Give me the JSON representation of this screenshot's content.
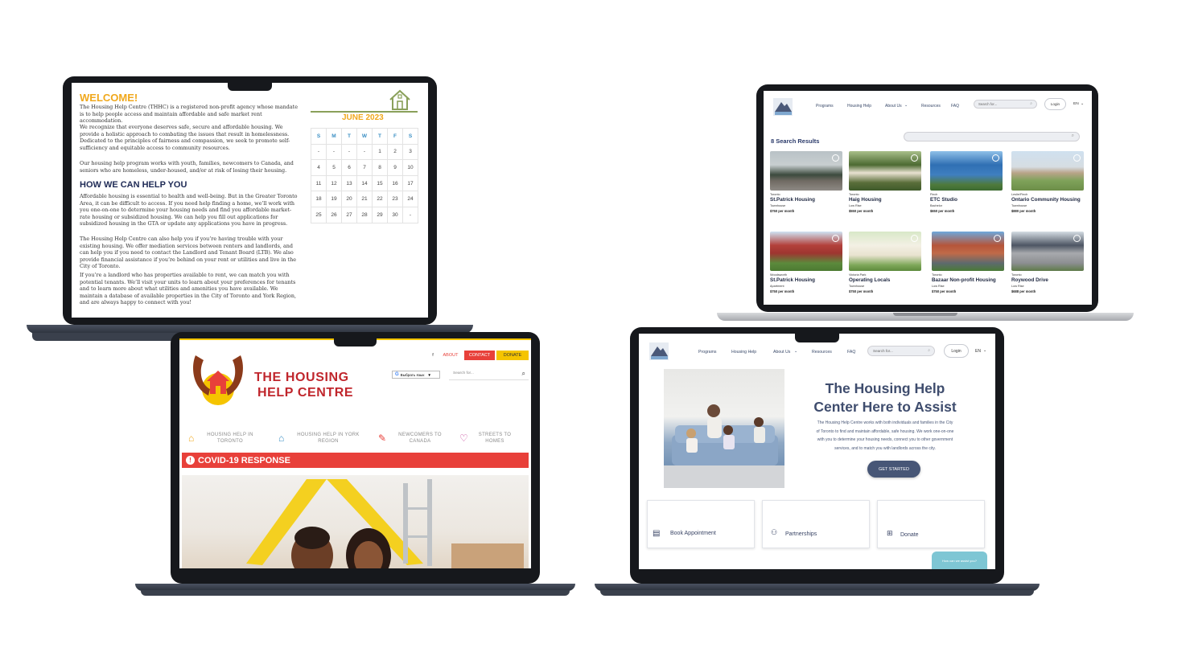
{
  "laptop1": {
    "welcome_title": "WELCOME!",
    "intro_paragraphs": [
      "The Housing Help Centre (THHC) is a registered non-profit agency whose mandate is to help people access and maintain affordable and safe market rent accommodation.",
      "We recognize that everyone deserves safe, secure and affordable housing. We provide a holistic approach to combating the issues that result in homelessness. Dedicated to the principles of fairness and compassion, we seek to promote self-sufficiency and equitable access to community resources.",
      "Our housing help program works with youth, families, newcomers to Canada, and seniors who are homeless, under-housed, and/or at risk of losing their housing."
    ],
    "how_title": "HOW WE CAN HELP YOU",
    "how_paragraphs": [
      "Affordable housing is essential to health and well-being. But in the Greater Toronto Area, it can be difficult to access. If you need help finding a home, we’ll work with you one-on-one to determine your housing needs and find you affordable market-rate housing or subsidized housing. We can help you fill out applications for subsidized housing in the GTA or update any applications you have in progress.",
      "The Housing Help Centre can also help you if you’re having trouble with your existing housing. We offer mediation services between renters and landlords, and can help you if you need to contact the Landlord and Tenant Board (LTB). We also provide financial assistance if you’re behind on your rent or utilities and live in the City of Toronto.",
      "If you’re a landlord who has properties available to rent, we can match you with potential tenants. We’ll visit your units to learn about your preferences for tenants and to learn more about what utilities and amenities you have available. We maintain a database of available properties in the City of Toronto and York Region, and are always happy to connect with you!"
    ],
    "calendar": {
      "month": "JUNE 2023",
      "days": [
        "S",
        "M",
        "T",
        "W",
        "T",
        "F",
        "S"
      ],
      "weeks": [
        [
          "-",
          "-",
          "-",
          "-",
          "1",
          "2",
          "3"
        ],
        [
          "4",
          "5",
          "6",
          "7",
          "8",
          "9",
          "10"
        ],
        [
          "11",
          "12",
          "13",
          "14",
          "15",
          "16",
          "17"
        ],
        [
          "18",
          "19",
          "20",
          "21",
          "22",
          "23",
          "24"
        ],
        [
          "25",
          "26",
          "27",
          "28",
          "29",
          "30",
          "-"
        ]
      ]
    }
  },
  "laptop2": {
    "nav": [
      "Programs",
      "Housing Help",
      "About Us",
      "Resources",
      "FAQ"
    ],
    "search_placeholder": "Search for...",
    "login": "Login",
    "lang": "EN",
    "results_title": "8 Search Results",
    "listings": [
      {
        "location": "Toronto",
        "name": "St.Patrick Housing",
        "type": "Townhouse",
        "price": "$750 per month"
      },
      {
        "location": "Toronto",
        "name": "Haig Housing",
        "type": "Low Rise",
        "price": "$550 per month"
      },
      {
        "location": "Finch",
        "name": "ETC Studio",
        "type": "Bachelor",
        "price": "$650 per month"
      },
      {
        "location": "Leslie/Finch",
        "name": "Ontario Community Housing",
        "type": "Townhouse",
        "price": "$880 per month"
      },
      {
        "location": "Woodsworth",
        "name": "St.Patrick Housing",
        "type": "Apartment",
        "price": "$750 per month"
      },
      {
        "location": "Victoria Park",
        "name": "Operating Locals",
        "type": "Townhouse",
        "price": "$750 per month"
      },
      {
        "location": "Toronto",
        "name": "Bazaar Non-profit Housing",
        "type": "Low Rise",
        "price": "$750 per month"
      },
      {
        "location": "Toronto",
        "name": "Roywood Drive",
        "type": "Low Rise",
        "price": "$688 per month"
      }
    ]
  },
  "laptop3": {
    "top_links": {
      "facebook": "f",
      "about": "ABOUT",
      "contact": "CONTACT",
      "donate": "DONATE"
    },
    "brand_line1": "THE HOUSING",
    "brand_line2": "HELP CENTRE",
    "translate": "Выбрать язык",
    "search_placeholder": "Search for...",
    "categories": [
      {
        "line1": "HOUSING HELP IN",
        "line2": "TORONTO"
      },
      {
        "line1": "HOUSING HELP IN YORK",
        "line2": "REGION"
      },
      {
        "line1": "NEWCOMERS TO",
        "line2": "CANADA"
      },
      {
        "line1": "STREETS TO",
        "line2": "HOMES"
      }
    ],
    "alert": "COVID-19 RESPONSE"
  },
  "laptop4": {
    "nav": [
      "Programs",
      "Housing Help",
      "About Us",
      "Resources",
      "FAQ"
    ],
    "search_placeholder": "Search for...",
    "login": "Login",
    "lang": "EN",
    "hero_title_line1": "The Housing Help",
    "hero_title_line2": "Center Here to Assist",
    "hero_lines": [
      "The Housing Help Centre works with both individuals and families in the City",
      "of Toronto to find and maintain affordable, safe housing. We work one-on-one",
      "with you to determine your housing needs, connect you to other government",
      "services, and to match you with landlords across the city."
    ],
    "cta": "GET STARTED",
    "tiles": [
      "Book Appointment",
      "Partnerships",
      "Donate"
    ],
    "chat": "How can we assist you?"
  },
  "colors": {
    "orange": "#f0a81c",
    "navy": "#1e2a55",
    "red": "#e8403a",
    "slate": "#4a5878",
    "yellow": "#f5c400"
  }
}
